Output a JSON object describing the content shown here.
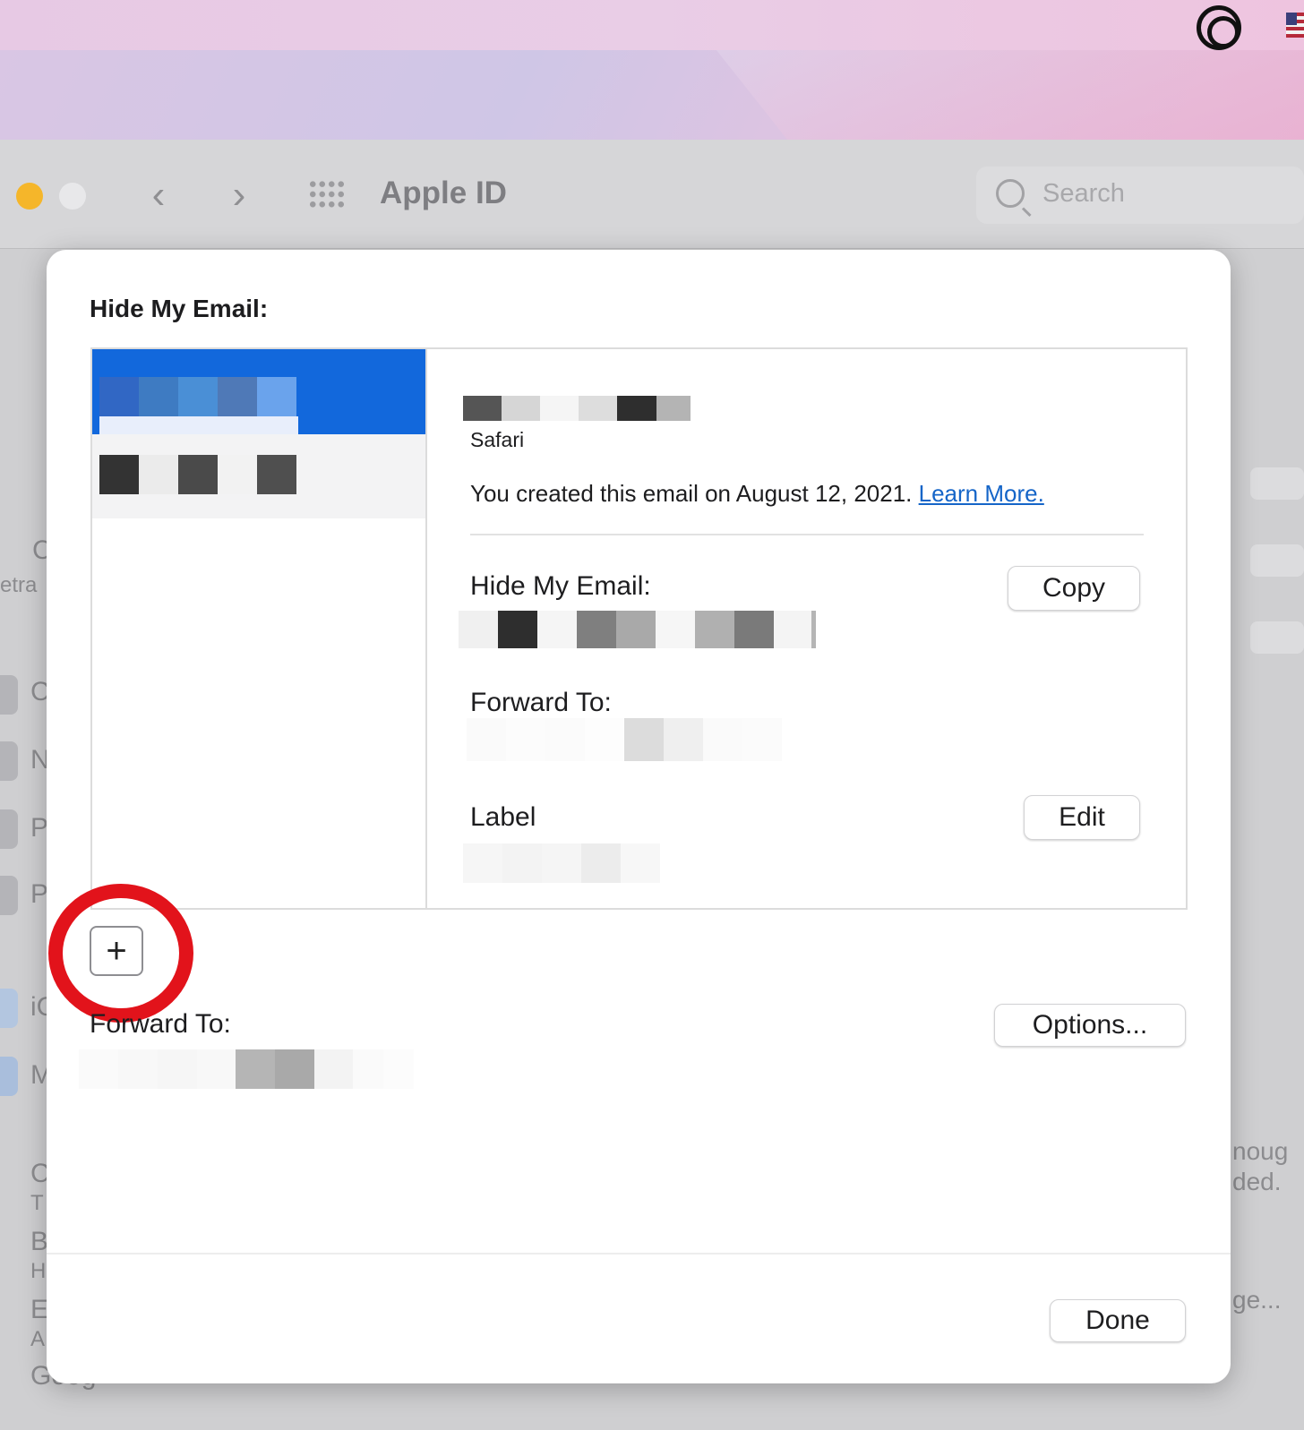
{
  "window": {
    "title": "Apple ID",
    "search_placeholder": "Search"
  },
  "background_fragments": {
    "left_letters": [
      "C",
      "etra",
      "C",
      "N",
      "P",
      "P",
      "iC",
      "M",
      "C",
      "T",
      "B",
      "H",
      "E",
      "A",
      "Goog"
    ],
    "right_fragments": [
      "noug",
      "ded.",
      "ge..."
    ]
  },
  "sheet": {
    "heading": "Hide My Email:",
    "detail": {
      "app_name": "Safari",
      "created_text": "You created this email on August 12, 2021.",
      "learn_more": "Learn More.",
      "hide_my_email_label": "Hide My Email:",
      "copy_button": "Copy",
      "forward_to_label": "Forward To:",
      "label_label": "Label",
      "edit_button": "Edit"
    },
    "add_button": "+",
    "forward_to_label": "Forward To:",
    "options_button": "Options...",
    "done_button": "Done"
  },
  "colors": {
    "selection": "#1268dc",
    "link": "#1565c8",
    "highlight_ring": "#e2131b"
  },
  "icons": {
    "menubar_extra": "circle-target-icon",
    "menubar_flag": "us-flag-icon",
    "nav_back": "chevron-left-icon",
    "nav_forward": "chevron-right-icon",
    "grid": "grid-icon",
    "search": "search-icon"
  }
}
